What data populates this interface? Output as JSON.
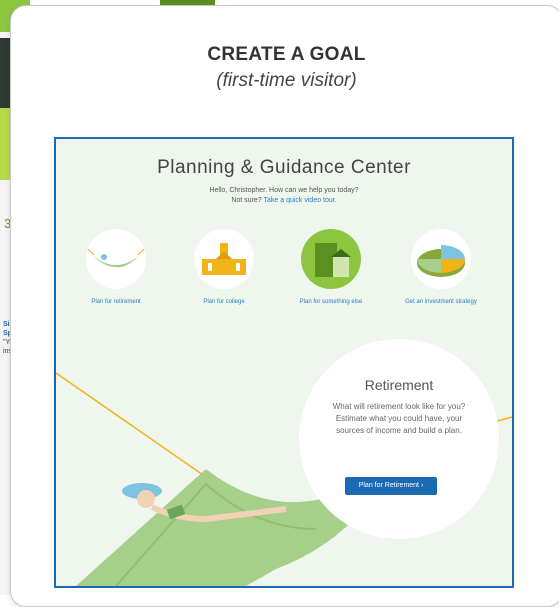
{
  "background_slide": {
    "number": "3",
    "link_text_1": "Si",
    "link_text_2": "Sp",
    "small_text_1": "\"Yo",
    "small_text_2": "ins"
  },
  "card": {
    "title": "CREATE A GOAL",
    "subtitle": "(first-time visitor)"
  },
  "screenshot": {
    "title": "Planning & Guidance Center",
    "greeting": "Hello, Christopher. How can we help you today?",
    "not_sure": "Not sure?",
    "not_sure_link": "Take a quick video tour.",
    "options": [
      {
        "label": "Plan for retirement"
      },
      {
        "label": "Plan for college"
      },
      {
        "label": "Plan for something else"
      },
      {
        "label": "Get an investment strategy"
      }
    ],
    "hero": {
      "title": "Retirement",
      "text": "What will retirement look like for you? Estimate what you could have, your sources of income and build a plan.",
      "button_label": "Plan for Retirement  ›"
    }
  },
  "colors": {
    "frame_blue": "#1a6ab4",
    "screenshot_bg": "#eef6ee",
    "hammock_green": "#a6cf8a",
    "rope_yellow": "#f2b316",
    "accent_green": "#8cc63f"
  }
}
